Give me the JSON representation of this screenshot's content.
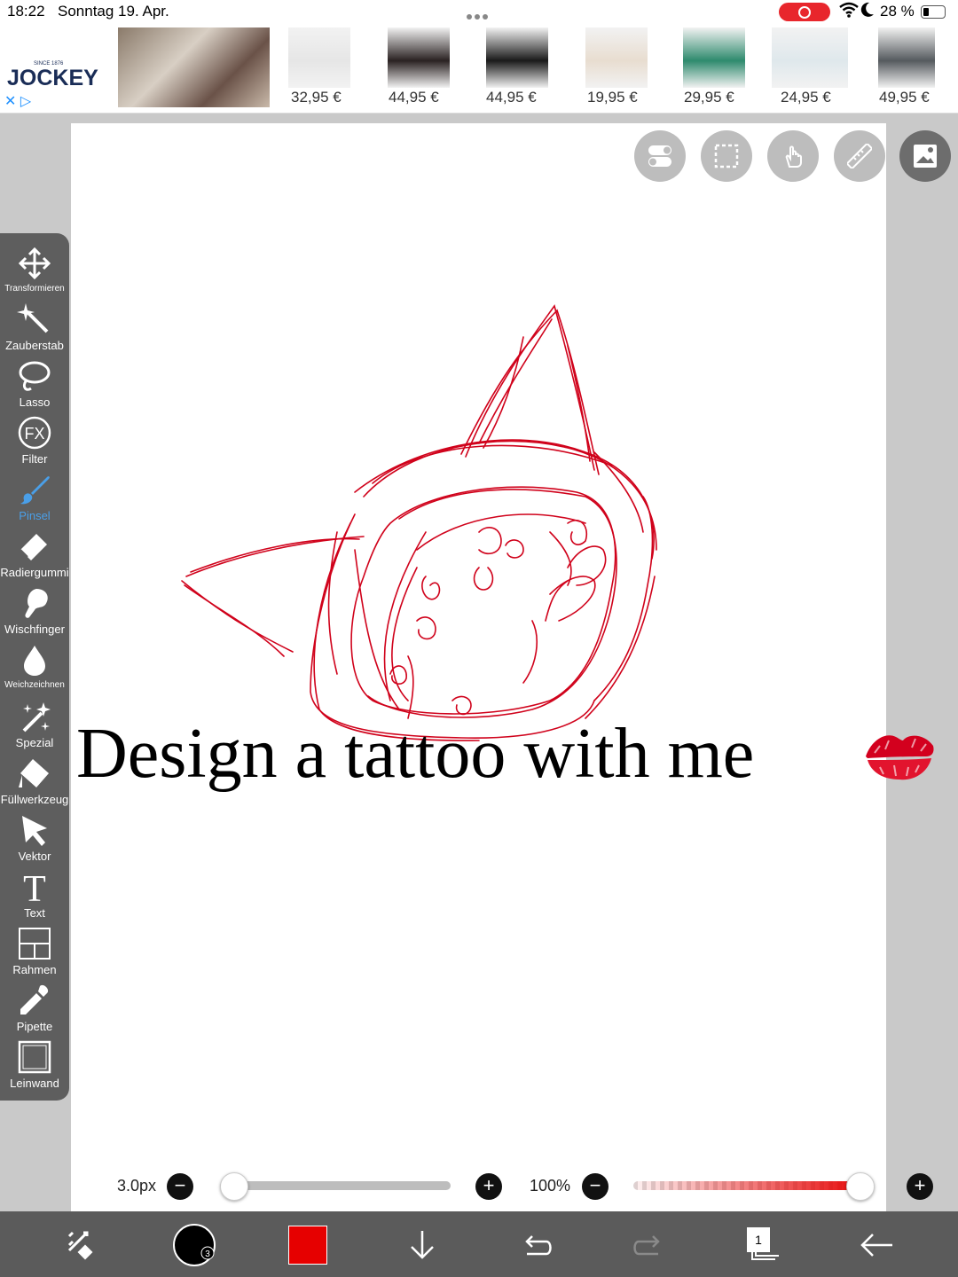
{
  "status_bar": {
    "time": "18:22",
    "date": "Sonntag 19. Apr.",
    "battery_percent": "28 %",
    "battery_level": 0.28
  },
  "ad": {
    "brand": "JOCKEY",
    "since": "SINCE 1876",
    "prices": [
      "32,95 €",
      "44,95 €",
      "44,95 €",
      "19,95 €",
      "29,95 €",
      "24,95 €",
      "49,95 €"
    ]
  },
  "canvas": {
    "overlay_text": "Design a tattoo with me",
    "sketch_color": "#d0021b"
  },
  "top_buttons": [
    "toggle-icon",
    "selection-icon",
    "hand-icon",
    "ruler-icon",
    "image-icon"
  ],
  "toolbar": {
    "tools": [
      {
        "label": "Transformieren",
        "icon": "move-icon"
      },
      {
        "label": "Zauberstab",
        "icon": "magic-wand-icon"
      },
      {
        "label": "Lasso",
        "icon": "lasso-icon"
      },
      {
        "label": "Filter",
        "icon": "fx-icon"
      },
      {
        "label": "Pinsel",
        "icon": "brush-icon",
        "active": true
      },
      {
        "label": "Radiergummi",
        "icon": "eraser-icon"
      },
      {
        "label": "Wischfinger",
        "icon": "smudge-icon"
      },
      {
        "label": "Weichzeichnen",
        "icon": "blur-drop-icon"
      },
      {
        "label": "Spezial",
        "icon": "special-wand-icon"
      },
      {
        "label": "Füllwerkzeug",
        "icon": "fill-bucket-icon"
      },
      {
        "label": "Vektor",
        "icon": "vector-arrow-icon"
      },
      {
        "label": "Text",
        "icon": "text-icon"
      },
      {
        "label": "Rahmen",
        "icon": "frame-icon"
      },
      {
        "label": "Pipette",
        "icon": "eyedropper-icon"
      },
      {
        "label": "Leinwand",
        "icon": "canvas-icon"
      }
    ]
  },
  "brush": {
    "size_label": "3.0px",
    "size_value": 0.0,
    "opacity_label": "100%",
    "opacity_value": 1.0
  },
  "bottom_bar": {
    "items": [
      "swap-icon",
      "brush-preview-icon",
      "color-swatch",
      "download-arrow-icon",
      "undo-icon",
      "redo-icon",
      "layers-icon",
      "back-arrow-icon"
    ],
    "layer_count": "1",
    "brush_preview_badge": "3",
    "current_color": "#e60000"
  }
}
